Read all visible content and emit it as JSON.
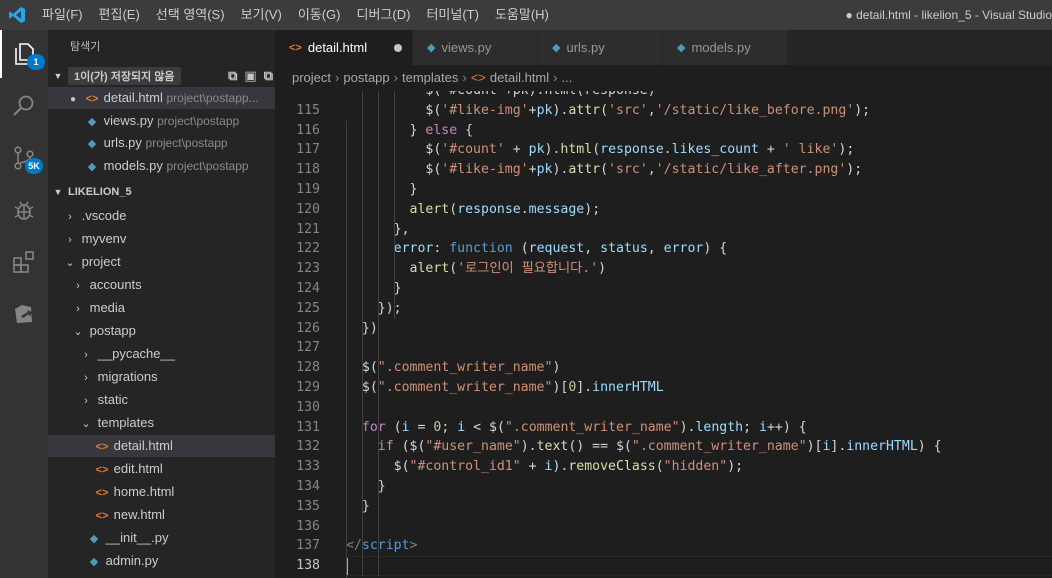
{
  "window": {
    "title": "● detail.html - likelion_5 - Visual Studio"
  },
  "menu": [
    "파일(F)",
    "편집(E)",
    "선택 영역(S)",
    "보기(V)",
    "이동(G)",
    "디버그(D)",
    "터미널(T)",
    "도움말(H)"
  ],
  "activity": {
    "explorer_badge": "1",
    "scm_badge": "5K"
  },
  "sidebar": {
    "title": "탐색기",
    "open_editors": {
      "label": "1이(가) 저장되지 않음",
      "items": [
        {
          "icon": "html",
          "name": "detail.html",
          "path": "project\\postapp...",
          "modified": true,
          "selected": true
        },
        {
          "icon": "py",
          "name": "views.py",
          "path": "project\\postapp"
        },
        {
          "icon": "py",
          "name": "urls.py",
          "path": "project\\postapp"
        },
        {
          "icon": "py",
          "name": "models.py",
          "path": "project\\postapp"
        }
      ]
    },
    "workspace": {
      "label": "LIKELION_5",
      "tree": [
        {
          "indent": 0,
          "type": "folder",
          "open": false,
          "name": ".vscode"
        },
        {
          "indent": 0,
          "type": "folder",
          "open": false,
          "name": "myvenv"
        },
        {
          "indent": 0,
          "type": "folder",
          "open": true,
          "name": "project"
        },
        {
          "indent": 1,
          "type": "folder",
          "open": false,
          "name": "accounts"
        },
        {
          "indent": 1,
          "type": "folder",
          "open": false,
          "name": "media"
        },
        {
          "indent": 1,
          "type": "folder",
          "open": true,
          "name": "postapp"
        },
        {
          "indent": 2,
          "type": "folder",
          "open": false,
          "name": "__pycache__"
        },
        {
          "indent": 2,
          "type": "folder",
          "open": false,
          "name": "migrations"
        },
        {
          "indent": 2,
          "type": "folder",
          "open": false,
          "name": "static"
        },
        {
          "indent": 2,
          "type": "folder",
          "open": true,
          "name": "templates"
        },
        {
          "indent": 3,
          "type": "html",
          "name": "detail.html",
          "selected": true
        },
        {
          "indent": 3,
          "type": "html",
          "name": "edit.html"
        },
        {
          "indent": 3,
          "type": "html",
          "name": "home.html"
        },
        {
          "indent": 3,
          "type": "html",
          "name": "new.html"
        },
        {
          "indent": 2,
          "type": "py",
          "name": "__init__.py"
        },
        {
          "indent": 2,
          "type": "py",
          "name": "admin.py"
        },
        {
          "indent": 2,
          "type": "py",
          "name": ""
        }
      ]
    }
  },
  "tabs": [
    {
      "icon": "html",
      "label": "detail.html",
      "active": true,
      "modified": true
    },
    {
      "icon": "py",
      "label": "views.py"
    },
    {
      "icon": "py",
      "label": "urls.py"
    },
    {
      "icon": "py",
      "label": "models.py"
    }
  ],
  "breadcrumb": {
    "parts": [
      "project",
      "postapp",
      "templates",
      "detail.html",
      "..."
    ]
  },
  "editor": {
    "current_line": 138,
    "lines": [
      {
        "n": "",
        "t": [
          [
            "txt",
            "          "
          ],
          [
            "txt",
            "$('#count'+pk).html(response)"
          ]
        ]
      },
      {
        "n": "115",
        "t": [
          [
            "txt",
            "          $("
          ],
          [
            "str",
            "'#like-img'"
          ],
          [
            "txt",
            "+"
          ],
          [
            "var",
            "pk"
          ],
          [
            "txt",
            ")."
          ],
          [
            "fn",
            "attr"
          ],
          [
            "txt",
            "("
          ],
          [
            "str",
            "'src'"
          ],
          [
            "txt",
            ","
          ],
          [
            "str",
            "'/static/like_before.png'"
          ],
          [
            "txt",
            ");"
          ]
        ]
      },
      {
        "n": "116",
        "t": [
          [
            "txt",
            "        } "
          ],
          [
            "ctl",
            "else"
          ],
          [
            "txt",
            " {"
          ]
        ]
      },
      {
        "n": "117",
        "t": [
          [
            "txt",
            "          $("
          ],
          [
            "str",
            "'#count'"
          ],
          [
            "txt",
            " + "
          ],
          [
            "var",
            "pk"
          ],
          [
            "txt",
            ")."
          ],
          [
            "fn",
            "html"
          ],
          [
            "txt",
            "("
          ],
          [
            "var",
            "response"
          ],
          [
            "txt",
            "."
          ],
          [
            "var",
            "likes_count"
          ],
          [
            "txt",
            " + "
          ],
          [
            "str",
            "' like'"
          ],
          [
            "txt",
            ");"
          ]
        ]
      },
      {
        "n": "118",
        "t": [
          [
            "txt",
            "          $("
          ],
          [
            "str",
            "'#like-img'"
          ],
          [
            "txt",
            "+"
          ],
          [
            "var",
            "pk"
          ],
          [
            "txt",
            ")."
          ],
          [
            "fn",
            "attr"
          ],
          [
            "txt",
            "("
          ],
          [
            "str",
            "'src'"
          ],
          [
            "txt",
            ","
          ],
          [
            "str",
            "'/static/like_after.png'"
          ],
          [
            "txt",
            ");"
          ]
        ]
      },
      {
        "n": "119",
        "t": [
          [
            "txt",
            "        }"
          ]
        ]
      },
      {
        "n": "120",
        "t": [
          [
            "txt",
            "        "
          ],
          [
            "fn",
            "alert"
          ],
          [
            "txt",
            "("
          ],
          [
            "var",
            "response"
          ],
          [
            "txt",
            "."
          ],
          [
            "var",
            "message"
          ],
          [
            "txt",
            ");"
          ]
        ]
      },
      {
        "n": "121",
        "t": [
          [
            "txt",
            "      },"
          ]
        ]
      },
      {
        "n": "122",
        "t": [
          [
            "txt",
            "      "
          ],
          [
            "var",
            "error"
          ],
          [
            "txt",
            ": "
          ],
          [
            "kw",
            "function"
          ],
          [
            "txt",
            " ("
          ],
          [
            "var",
            "request"
          ],
          [
            "txt",
            ", "
          ],
          [
            "var",
            "status"
          ],
          [
            "txt",
            ", "
          ],
          [
            "var",
            "error"
          ],
          [
            "txt",
            ") {"
          ]
        ]
      },
      {
        "n": "123",
        "t": [
          [
            "txt",
            "        "
          ],
          [
            "fn",
            "alert"
          ],
          [
            "txt",
            "("
          ],
          [
            "str",
            "'로그인이 필요합니다.'"
          ],
          [
            "txt",
            ")"
          ]
        ]
      },
      {
        "n": "124",
        "t": [
          [
            "txt",
            "      }"
          ]
        ]
      },
      {
        "n": "125",
        "t": [
          [
            "txt",
            "    });"
          ]
        ]
      },
      {
        "n": "126",
        "t": [
          [
            "txt",
            "  })"
          ]
        ]
      },
      {
        "n": "127",
        "t": []
      },
      {
        "n": "128",
        "t": [
          [
            "txt",
            "  $("
          ],
          [
            "str",
            "\".comment_writer_name\""
          ],
          [
            "txt",
            ")"
          ]
        ]
      },
      {
        "n": "129",
        "t": [
          [
            "txt",
            "  $("
          ],
          [
            "str",
            "\".comment_writer_name\""
          ],
          [
            "txt",
            ")["
          ],
          [
            "num",
            "0"
          ],
          [
            "txt",
            "]."
          ],
          [
            "var",
            "innerHTML"
          ]
        ]
      },
      {
        "n": "130",
        "t": []
      },
      {
        "n": "131",
        "t": [
          [
            "txt",
            "  "
          ],
          [
            "ctl",
            "for"
          ],
          [
            "txt",
            " ("
          ],
          [
            "var",
            "i"
          ],
          [
            "txt",
            " = "
          ],
          [
            "num",
            "0"
          ],
          [
            "txt",
            "; "
          ],
          [
            "var",
            "i"
          ],
          [
            "txt",
            " < $("
          ],
          [
            "str",
            "\".comment_writer_name\""
          ],
          [
            "txt",
            ")."
          ],
          [
            "var",
            "length"
          ],
          [
            "txt",
            "; "
          ],
          [
            "var",
            "i"
          ],
          [
            "txt",
            "++) {"
          ]
        ]
      },
      {
        "n": "132",
        "t": [
          [
            "txt",
            "    "
          ],
          [
            "ctl",
            "if"
          ],
          [
            "txt",
            " ($("
          ],
          [
            "str",
            "\"#user_name\""
          ],
          [
            "txt",
            ")."
          ],
          [
            "fn",
            "text"
          ],
          [
            "txt",
            "() == $("
          ],
          [
            "str",
            "\".comment_writer_name\""
          ],
          [
            "txt",
            ")["
          ],
          [
            "var",
            "i"
          ],
          [
            "txt",
            "]."
          ],
          [
            "var",
            "innerHTML"
          ],
          [
            "txt",
            ") {"
          ]
        ]
      },
      {
        "n": "133",
        "t": [
          [
            "txt",
            "      $("
          ],
          [
            "str",
            "\"#control_id1\""
          ],
          [
            "txt",
            " + "
          ],
          [
            "var",
            "i"
          ],
          [
            "txt",
            ")."
          ],
          [
            "fn",
            "removeClass"
          ],
          [
            "txt",
            "("
          ],
          [
            "str",
            "\"hidden\""
          ],
          [
            "txt",
            ");"
          ]
        ]
      },
      {
        "n": "134",
        "t": [
          [
            "txt",
            "    }"
          ]
        ]
      },
      {
        "n": "135",
        "t": [
          [
            "txt",
            "  }"
          ]
        ]
      },
      {
        "n": "136",
        "t": []
      },
      {
        "n": "137",
        "t": [
          [
            "pun",
            "</"
          ],
          [
            "tag",
            "script"
          ],
          [
            "pun",
            ">"
          ]
        ]
      },
      {
        "n": "138",
        "t": []
      }
    ]
  }
}
